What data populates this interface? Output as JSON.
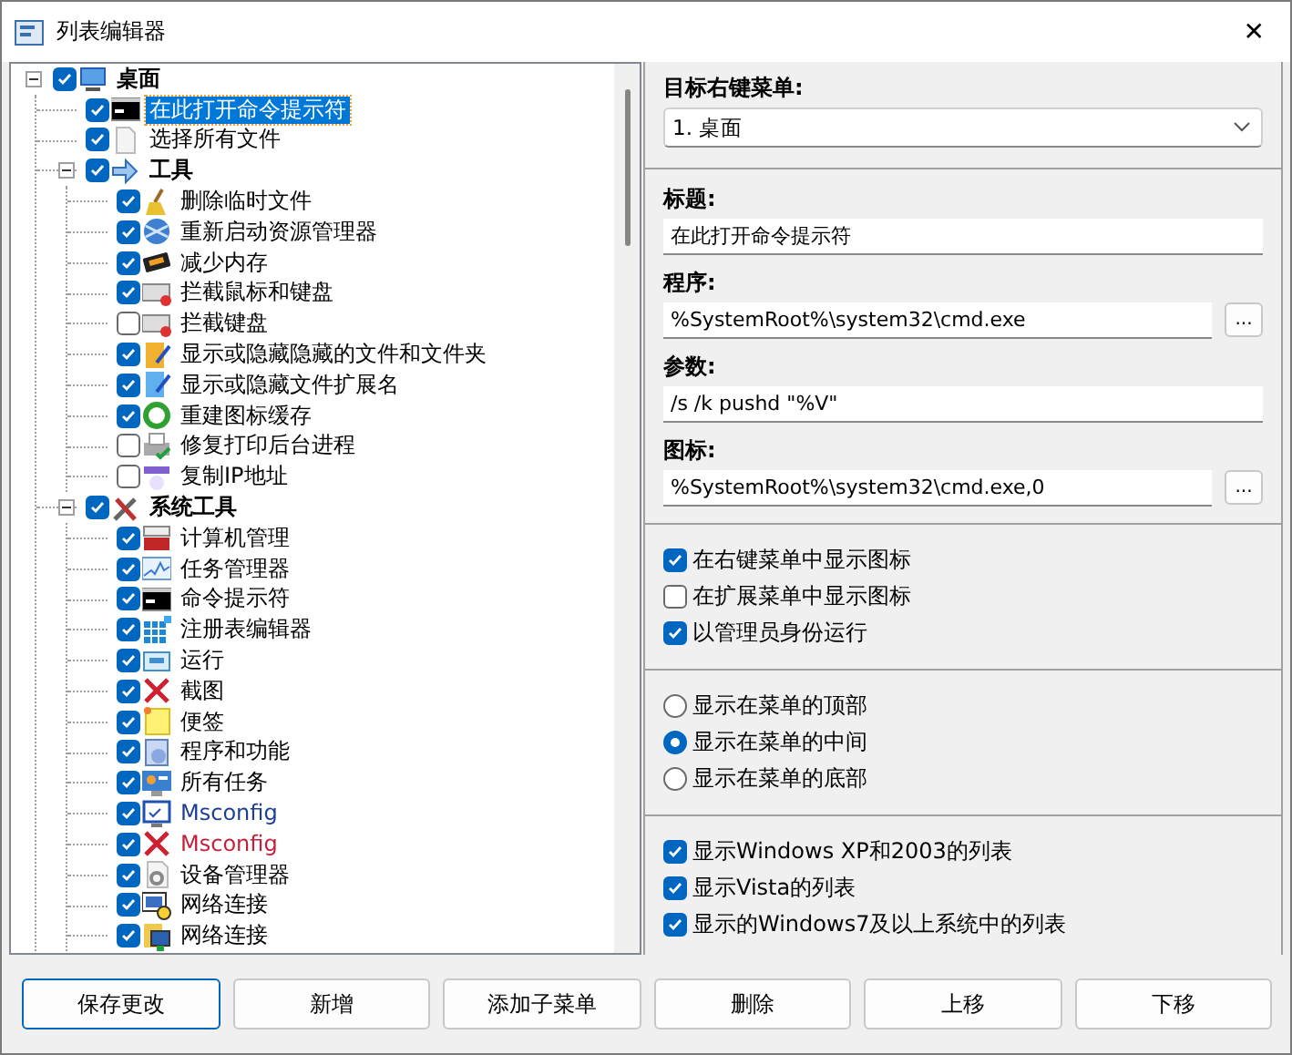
{
  "window": {
    "title": "列表编辑器",
    "close": "✕"
  },
  "tree": [
    {
      "label": "桌面",
      "checked": true,
      "expanded": true,
      "selected": false,
      "children": [
        {
          "label": "在此打开命令提示符",
          "checked": true,
          "selected": true
        },
        {
          "label": "选择所有文件",
          "checked": true,
          "selected": false
        },
        {
          "label": "工具",
          "checked": true,
          "expanded": true,
          "selected": false,
          "children": [
            {
              "label": "删除临时文件",
              "checked": true,
              "selected": false
            },
            {
              "label": "重新启动资源管理器",
              "checked": true,
              "selected": false
            },
            {
              "label": "减少内存",
              "checked": true,
              "selected": false
            },
            {
              "label": "拦截鼠标和键盘",
              "checked": true,
              "selected": false
            },
            {
              "label": "拦截键盘",
              "checked": false,
              "selected": false
            },
            {
              "label": "显示或隐藏隐藏的文件和文件夹",
              "checked": true,
              "selected": false
            },
            {
              "label": "显示或隐藏文件扩展名",
              "checked": true,
              "selected": false
            },
            {
              "label": "重建图标缓存",
              "checked": true,
              "selected": false
            },
            {
              "label": "修复打印后台进程",
              "checked": false,
              "selected": false
            },
            {
              "label": "复制IP地址",
              "checked": false,
              "selected": false
            }
          ]
        },
        {
          "label": "系统工具",
          "checked": true,
          "expanded": true,
          "selected": false,
          "children": [
            {
              "label": "计算机管理",
              "checked": true,
              "selected": false
            },
            {
              "label": "任务管理器",
              "checked": true,
              "selected": false
            },
            {
              "label": "命令提示符",
              "checked": true,
              "selected": false
            },
            {
              "label": "注册表编辑器",
              "checked": true,
              "selected": false
            },
            {
              "label": "运行",
              "checked": true,
              "selected": false
            },
            {
              "label": "截图",
              "checked": true,
              "selected": false
            },
            {
              "label": "便签",
              "checked": true,
              "selected": false
            },
            {
              "label": "程序和功能",
              "checked": true,
              "selected": false
            },
            {
              "label": "所有任务",
              "checked": true,
              "selected": false
            },
            {
              "label": "Msconfig",
              "checked": true,
              "selected": false,
              "color": "#1c3f94"
            },
            {
              "label": "Msconfig",
              "checked": true,
              "selected": false,
              "color": "#c4203a"
            },
            {
              "label": "设备管理器",
              "checked": true,
              "selected": false
            },
            {
              "label": "网络连接",
              "checked": true,
              "selected": false
            },
            {
              "label": "网络连接",
              "checked": true,
              "selected": false
            }
          ]
        }
      ]
    }
  ],
  "target_menu": {
    "label": "目标右键菜单:",
    "value": "1. 桌面"
  },
  "fields": [
    {
      "label": "标题:",
      "value": "在此打开命令提示符"
    },
    {
      "label": "程序:",
      "value": "%SystemRoot%\\system32\\cmd.exe",
      "browse": "..."
    },
    {
      "label": "参数:",
      "value": "/s /k pushd \"%V\""
    },
    {
      "label": "图标:",
      "value": "%SystemRoot%\\system32\\cmd.exe,0",
      "browse": "..."
    }
  ],
  "options": [
    {
      "label": "在右键菜单中显示图标",
      "checked": true
    },
    {
      "label": "在扩展菜单中显示图标",
      "checked": false
    },
    {
      "label": "以管理员身份运行",
      "checked": true
    }
  ],
  "position": [
    {
      "label": "显示在菜单的顶部",
      "selected": false
    },
    {
      "label": "显示在菜单的中间",
      "selected": true
    },
    {
      "label": "显示在菜单的底部",
      "selected": false
    }
  ],
  "versions": [
    {
      "label": "显示Windows XP和2003的列表",
      "checked": true
    },
    {
      "label": "显示Vista的列表",
      "checked": true
    },
    {
      "label": "显示的Windows7及以上系统中的列表",
      "checked": true
    }
  ],
  "buttons": [
    {
      "label": "保存更改",
      "default": true
    },
    {
      "label": "新增",
      "default": false
    },
    {
      "label": "添加子菜单",
      "default": false
    },
    {
      "label": "删除",
      "default": false
    },
    {
      "label": "上移",
      "default": false
    },
    {
      "label": "下移",
      "default": false
    }
  ]
}
